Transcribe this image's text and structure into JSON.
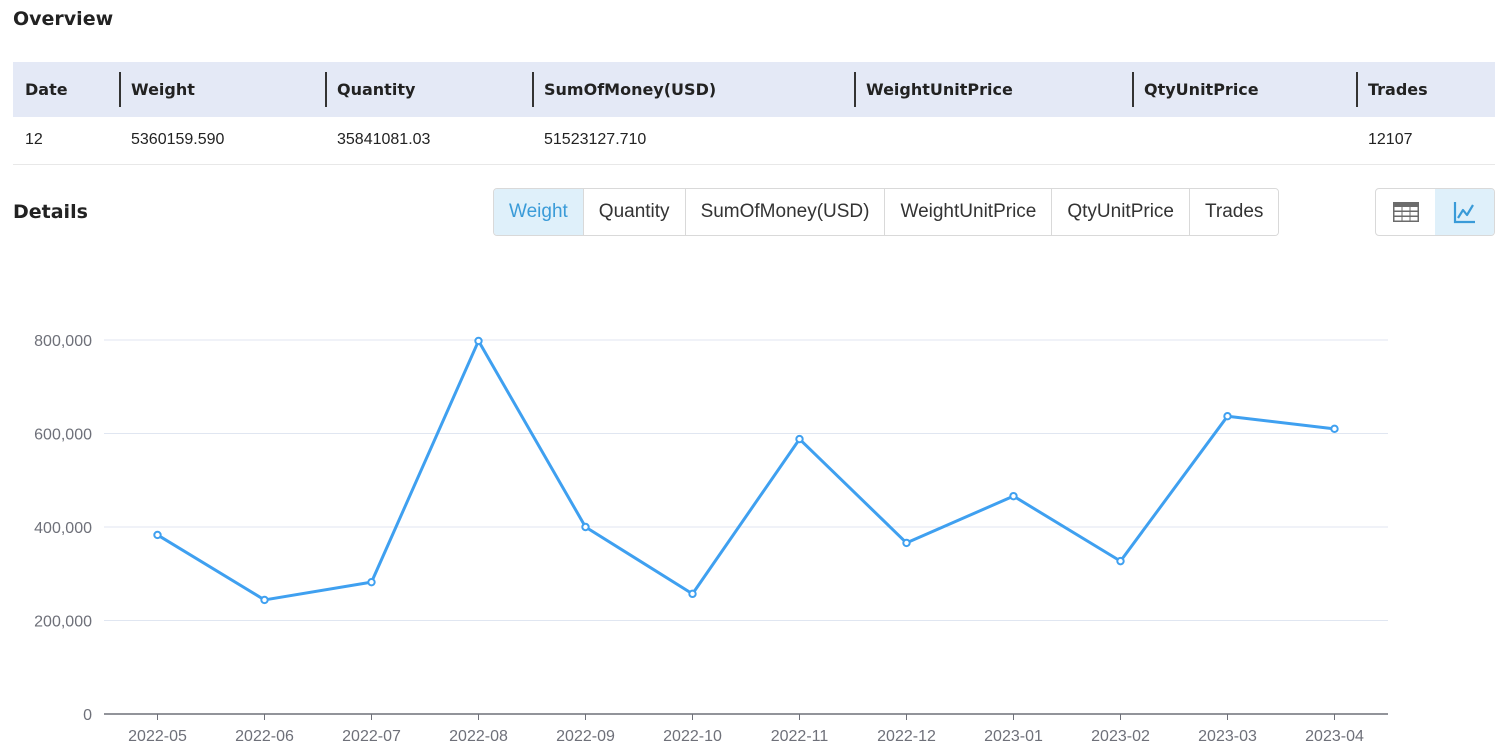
{
  "overview": {
    "title": "Overview",
    "columns": [
      "Date",
      "Weight",
      "Quantity",
      "SumOfMoney(USD)",
      "WeightUnitPrice",
      "QtyUnitPrice",
      "Trades"
    ],
    "row": [
      "12",
      "5360159.590",
      "35841081.03",
      "51523127.710",
      "",
      "",
      "12107"
    ]
  },
  "details": {
    "title": "Details",
    "tabs": [
      {
        "label": "Weight",
        "active": true
      },
      {
        "label": "Quantity",
        "active": false
      },
      {
        "label": "SumOfMoney(USD)",
        "active": false
      },
      {
        "label": "WeightUnitPrice",
        "active": false
      },
      {
        "label": "QtyUnitPrice",
        "active": false
      },
      {
        "label": "Trades",
        "active": false
      }
    ],
    "view_toggle": [
      {
        "icon": "table-icon",
        "active": false
      },
      {
        "icon": "line-chart-icon",
        "active": true
      }
    ]
  },
  "colors": {
    "line": "#3fa0f0",
    "grid": "#e0e6f1",
    "axis": "#6e7079",
    "active_tab_bg": "#dff0fa",
    "active_tab_text": "#3a9bd8"
  },
  "chart_data": {
    "type": "line",
    "title": "",
    "xlabel": "",
    "ylabel": "",
    "categories": [
      "2022-05",
      "2022-06",
      "2022-07",
      "2022-08",
      "2022-09",
      "2022-10",
      "2022-11",
      "2022-12",
      "2023-01",
      "2023-02",
      "2023-03",
      "2023-04"
    ],
    "series": [
      {
        "name": "Weight",
        "values": [
          383000,
          244000,
          282000,
          798000,
          400000,
          257000,
          588000,
          366000,
          466000,
          327000,
          637000,
          610000
        ]
      }
    ],
    "ylim": [
      0,
      800000
    ],
    "yticks": [
      0,
      200000,
      400000,
      600000,
      800000
    ],
    "ytick_labels": [
      "0",
      "200,000",
      "400,000",
      "600,000",
      "800,000"
    ],
    "grid": true,
    "legend": "none"
  }
}
